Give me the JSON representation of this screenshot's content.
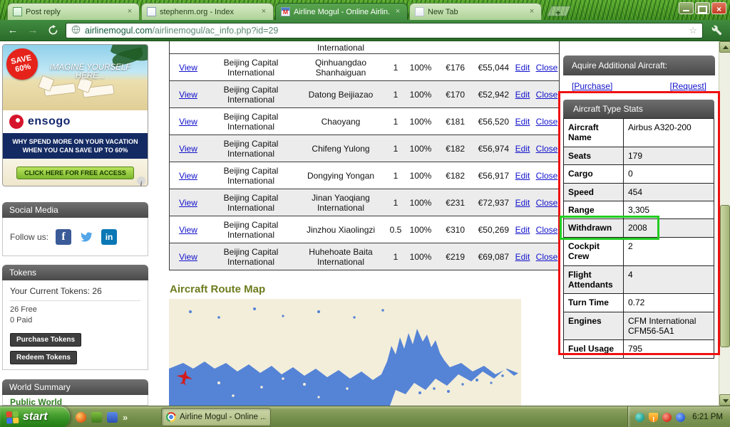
{
  "browser": {
    "tabs": [
      {
        "title": "Post reply",
        "favicon": "page-green",
        "active": false
      },
      {
        "title": "stephenm.org - Index",
        "favicon": "page",
        "active": false
      },
      {
        "title": "Airline Mogul - Online Airlin...",
        "favicon": "airline-mogul",
        "active": true
      },
      {
        "title": "New Tab",
        "favicon": "blank",
        "active": false
      }
    ],
    "url_domain": "airlinemogul.com",
    "url_path": "/airlinemogul/ac_info.php?id=29"
  },
  "ad": {
    "save_line1": "SAVE",
    "save_line2": "60%",
    "headline": "IMAGINE YOURSELF HERE...",
    "brand": "ensogo",
    "tagline_line1": "WHY SPEND MORE ON YOUR VACATION",
    "tagline_line2": "WHEN YOU CAN SAVE UP TO 60%",
    "cta": "CLICK HERE FOR FREE ACCESS"
  },
  "social": {
    "title": "Social Media",
    "follow_label": "Follow us:"
  },
  "tokens": {
    "title": "Tokens",
    "current_line": "Your Current Tokens: 26",
    "free_line": "26 Free",
    "paid_line": "0 Paid",
    "purchase_button": "Purchase Tokens",
    "redeem_button": "Redeem Tokens"
  },
  "world_summary": {
    "title": "World Summary",
    "partial_line": "Public World"
  },
  "routes": {
    "partial_top_text": "International",
    "view_label": "View",
    "edit_label": "Edit",
    "close_label": "Close",
    "rows": [
      {
        "origin": "Beijing Capital International",
        "destination": "Qinhuangdao Shanhaiguan",
        "aircraft": "1",
        "load": "100%",
        "price": "€176",
        "revenue": "€55,044"
      },
      {
        "origin": "Beijing Capital International",
        "destination": "Datong Beijiazao",
        "aircraft": "1",
        "load": "100%",
        "price": "€170",
        "revenue": "€52,942"
      },
      {
        "origin": "Beijing Capital International",
        "destination": "Chaoyang",
        "aircraft": "1",
        "load": "100%",
        "price": "€181",
        "revenue": "€56,520"
      },
      {
        "origin": "Beijing Capital International",
        "destination": "Chifeng Yulong",
        "aircraft": "1",
        "load": "100%",
        "price": "€182",
        "revenue": "€56,974"
      },
      {
        "origin": "Beijing Capital International",
        "destination": "Dongying Yongan",
        "aircraft": "1",
        "load": "100%",
        "price": "€182",
        "revenue": "€56,917"
      },
      {
        "origin": "Beijing Capital International",
        "destination": "Jinan Yaoqiang International",
        "aircraft": "1",
        "load": "100%",
        "price": "€231",
        "revenue": "€72,937"
      },
      {
        "origin": "Beijing Capital International",
        "destination": "Jinzhou Xiaolingzi",
        "aircraft": "0.5",
        "load": "100%",
        "price": "€310",
        "revenue": "€50,269"
      },
      {
        "origin": "Beijing Capital International",
        "destination": "Huhehoate Baita International",
        "aircraft": "1",
        "load": "100%",
        "price": "€219",
        "revenue": "€69,087"
      }
    ]
  },
  "route_map": {
    "title": "Aircraft Route Map"
  },
  "acquire": {
    "title": "Aquire Additional Aircraft:",
    "purchase_link": "[Purchase]",
    "request_link": "[Request]"
  },
  "aircraft_stats": {
    "title": "Aircraft Type Stats",
    "rows": [
      {
        "label": "Aircraft Name",
        "value": "Airbus A320-200"
      },
      {
        "label": "Seats",
        "value": "179"
      },
      {
        "label": "Cargo",
        "value": "0"
      },
      {
        "label": "Speed",
        "value": "454"
      },
      {
        "label": "Range",
        "value": "3,305"
      },
      {
        "label": "Withdrawn",
        "value": "2008",
        "highlighted": true
      },
      {
        "label": "Cockpit Crew",
        "value": "2"
      },
      {
        "label": "Flight Attendants",
        "value": "4"
      },
      {
        "label": "Turn Time",
        "value": "0.72"
      },
      {
        "label": "Engines",
        "value": "CFM International CFM56-5A1"
      },
      {
        "label": "Fuel Usage",
        "value": "795"
      }
    ]
  },
  "annotations": {
    "stats_box_color": "#ee1111",
    "withdrawn_box_color": "#22cc22"
  },
  "taskbar": {
    "start_label": "start",
    "task_button_label": "Airline Mogul - Online ...",
    "clock": "6:21 PM"
  }
}
